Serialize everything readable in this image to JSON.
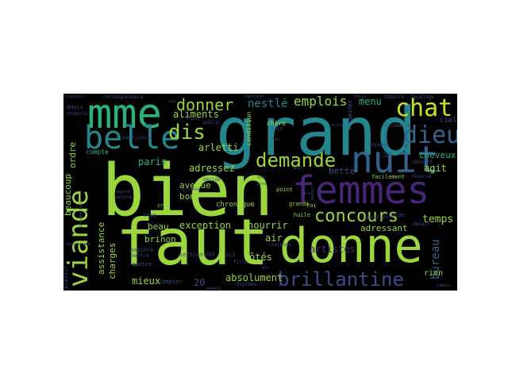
{
  "palette": {
    "background": "#000000",
    "lime": "#9bd63f",
    "green": "#2ab27b",
    "teal": "#23868d",
    "blue": "#33638d",
    "indigo": "#3e4a89",
    "purple": "#482677",
    "dark": "#40147a",
    "yellow": "#cbe11e"
  },
  "words": {
    "bien": "bien",
    "faut": "faut",
    "grand": "grand",
    "donne": "donne",
    "femmes": "femmes",
    "mme": "mme",
    "belle": "belle",
    "nuit": "nuit",
    "chat": "chat",
    "dieu": "dieu",
    "viande": "viande",
    "concours": "concours",
    "demande": "demande",
    "brillantine": "brillantine",
    "dis": "dis",
    "donner": "donner",
    "emplois": "emplois",
    "menu": "menu",
    "nestle": "nestlé",
    "aliments": "aliments",
    "arletti": "arletti",
    "paris": "paris",
    "adressez": "adressez",
    "bette": "bette",
    "bureau": "bureau",
    "temps": "temps",
    "agit": "agit",
    "cheveux": "cheveux",
    "ciel": "ciel",
    "exception": "exception",
    "nourrir": "nourrir",
    "artistes": "artistes",
    "adressant": "adressant",
    "beau": "beau",
    "air": "air",
    "otes": "ôtés",
    "absolument": "absolument",
    "mieux": "mieux",
    "vingt": "20",
    "charges": "charges",
    "assistance": "assistance",
    "beaucoup": "beaucoup",
    "ordre": "ordre",
    "avenue": "avenue",
    "brinon": "brinon",
    "bon": "bon",
    "rien": "rien",
    "chronique": "chronique",
    "correspondance": "correspondance",
    "davis": "davis",
    "medecin": "médecin",
    "compte": "compte",
    "condition": "condition",
    "chere": "chère",
    "theatre": "théatre",
    "doublage": "doublage",
    "vitamines": "vitamines",
    "donnant": "donnant",
    "facilement": "facilement",
    "reserve": "réservé",
    "desert": "désert",
    "huile": "huile",
    "grande": "grande",
    "point": "point",
    "public": "public",
    "section": "section",
    "quatre": "quatre",
    "matiere": "matière",
    "plaisir": "plaisir",
    "diplome": "diplôme",
    "roi": "roi",
    "fluide": "fluide",
    "crus": "crus",
    "trop": "trop",
    "mettre": "mettre",
    "compter": "compter",
    "etat": "état",
    "ici": "ici",
    "fille": "fille",
    "voyage": "voyage",
    "physique": "physique",
    "balneaire": "balnéaire",
    "cuit": "cuit",
    "napoleon": "napoléon",
    "francais": "français",
    "decide": "décide",
    "propos": "propos",
    "suivre": "suivre",
    "jamais": "jamais",
    "moment": "moment",
    "maison": "maison",
    "lubrifier": "lubrifier",
    "fruits": "fruits",
    "mois": "mois",
    "non": "non",
    "etc": "etc",
    "cosiques": "cosiques",
    "publicitaire": "publicitaire",
    "minorerait": "minorerait",
    "aspire": "aspire",
    "encore": "encore",
    "pharmacien": "pharmacien",
    "gras": "gras",
    "ecole": "école",
    "foule": "foule",
    "tout": "tout",
    "pure": "pure",
    "lieu": "lieu"
  }
}
